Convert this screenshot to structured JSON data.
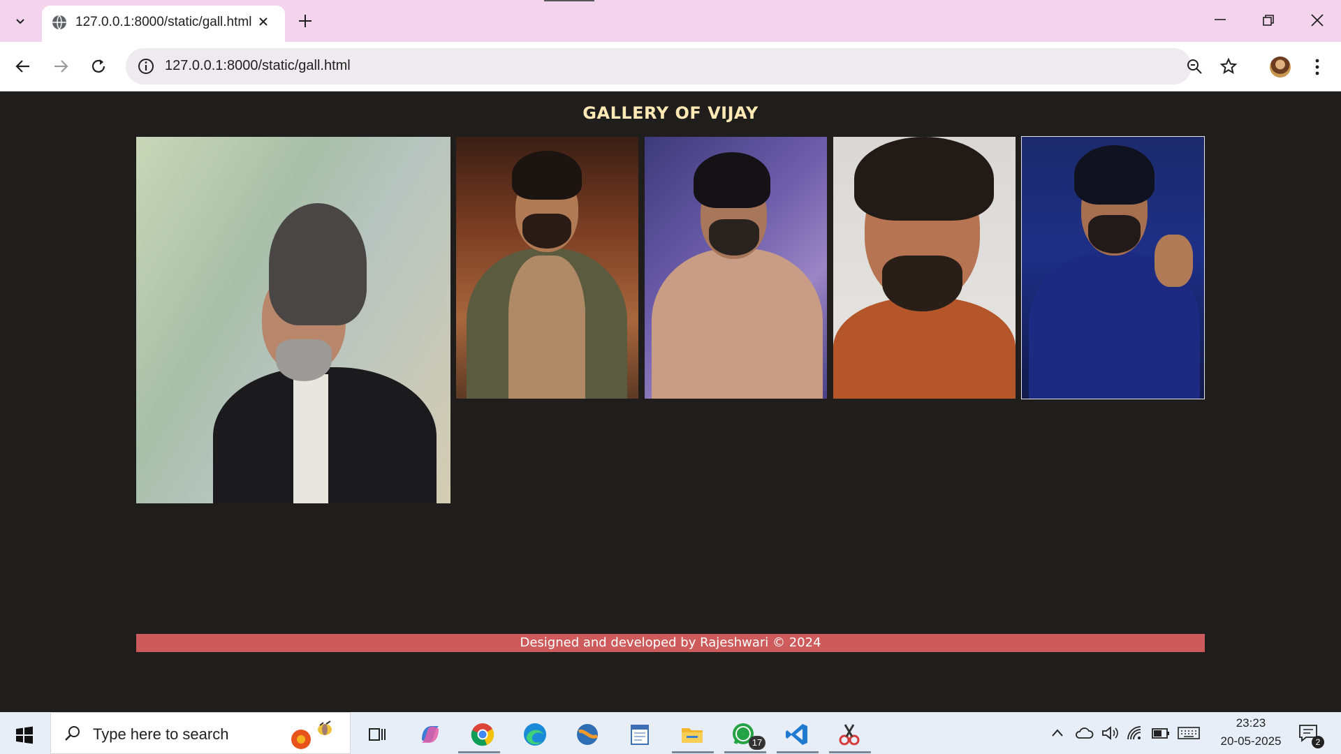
{
  "browser": {
    "tab_title": "127.0.0.1:8000/static/gall.html",
    "url": "127.0.0.1:8000/static/gall.html"
  },
  "page": {
    "title": "GALLERY OF VIJAY",
    "footer": "Designed and developed by Rajeshwari © 2024",
    "colors": {
      "background": "#201d1d",
      "title": "#ffe9b5",
      "footer_bar": "#cd5b5b"
    }
  },
  "gallery": {
    "photos": [
      {
        "name": "gallery-photo-1",
        "icon": "portrait-image"
      },
      {
        "name": "gallery-photo-2",
        "icon": "portrait-image"
      },
      {
        "name": "gallery-photo-3",
        "icon": "portrait-image"
      },
      {
        "name": "gallery-photo-4",
        "icon": "portrait-image"
      },
      {
        "name": "gallery-photo-5",
        "icon": "portrait-image"
      }
    ]
  },
  "taskbar": {
    "search_placeholder": "Type here to search",
    "whatsapp_badge": "17",
    "time": "23:23",
    "date": "20-05-2025",
    "notification_count": "2"
  }
}
